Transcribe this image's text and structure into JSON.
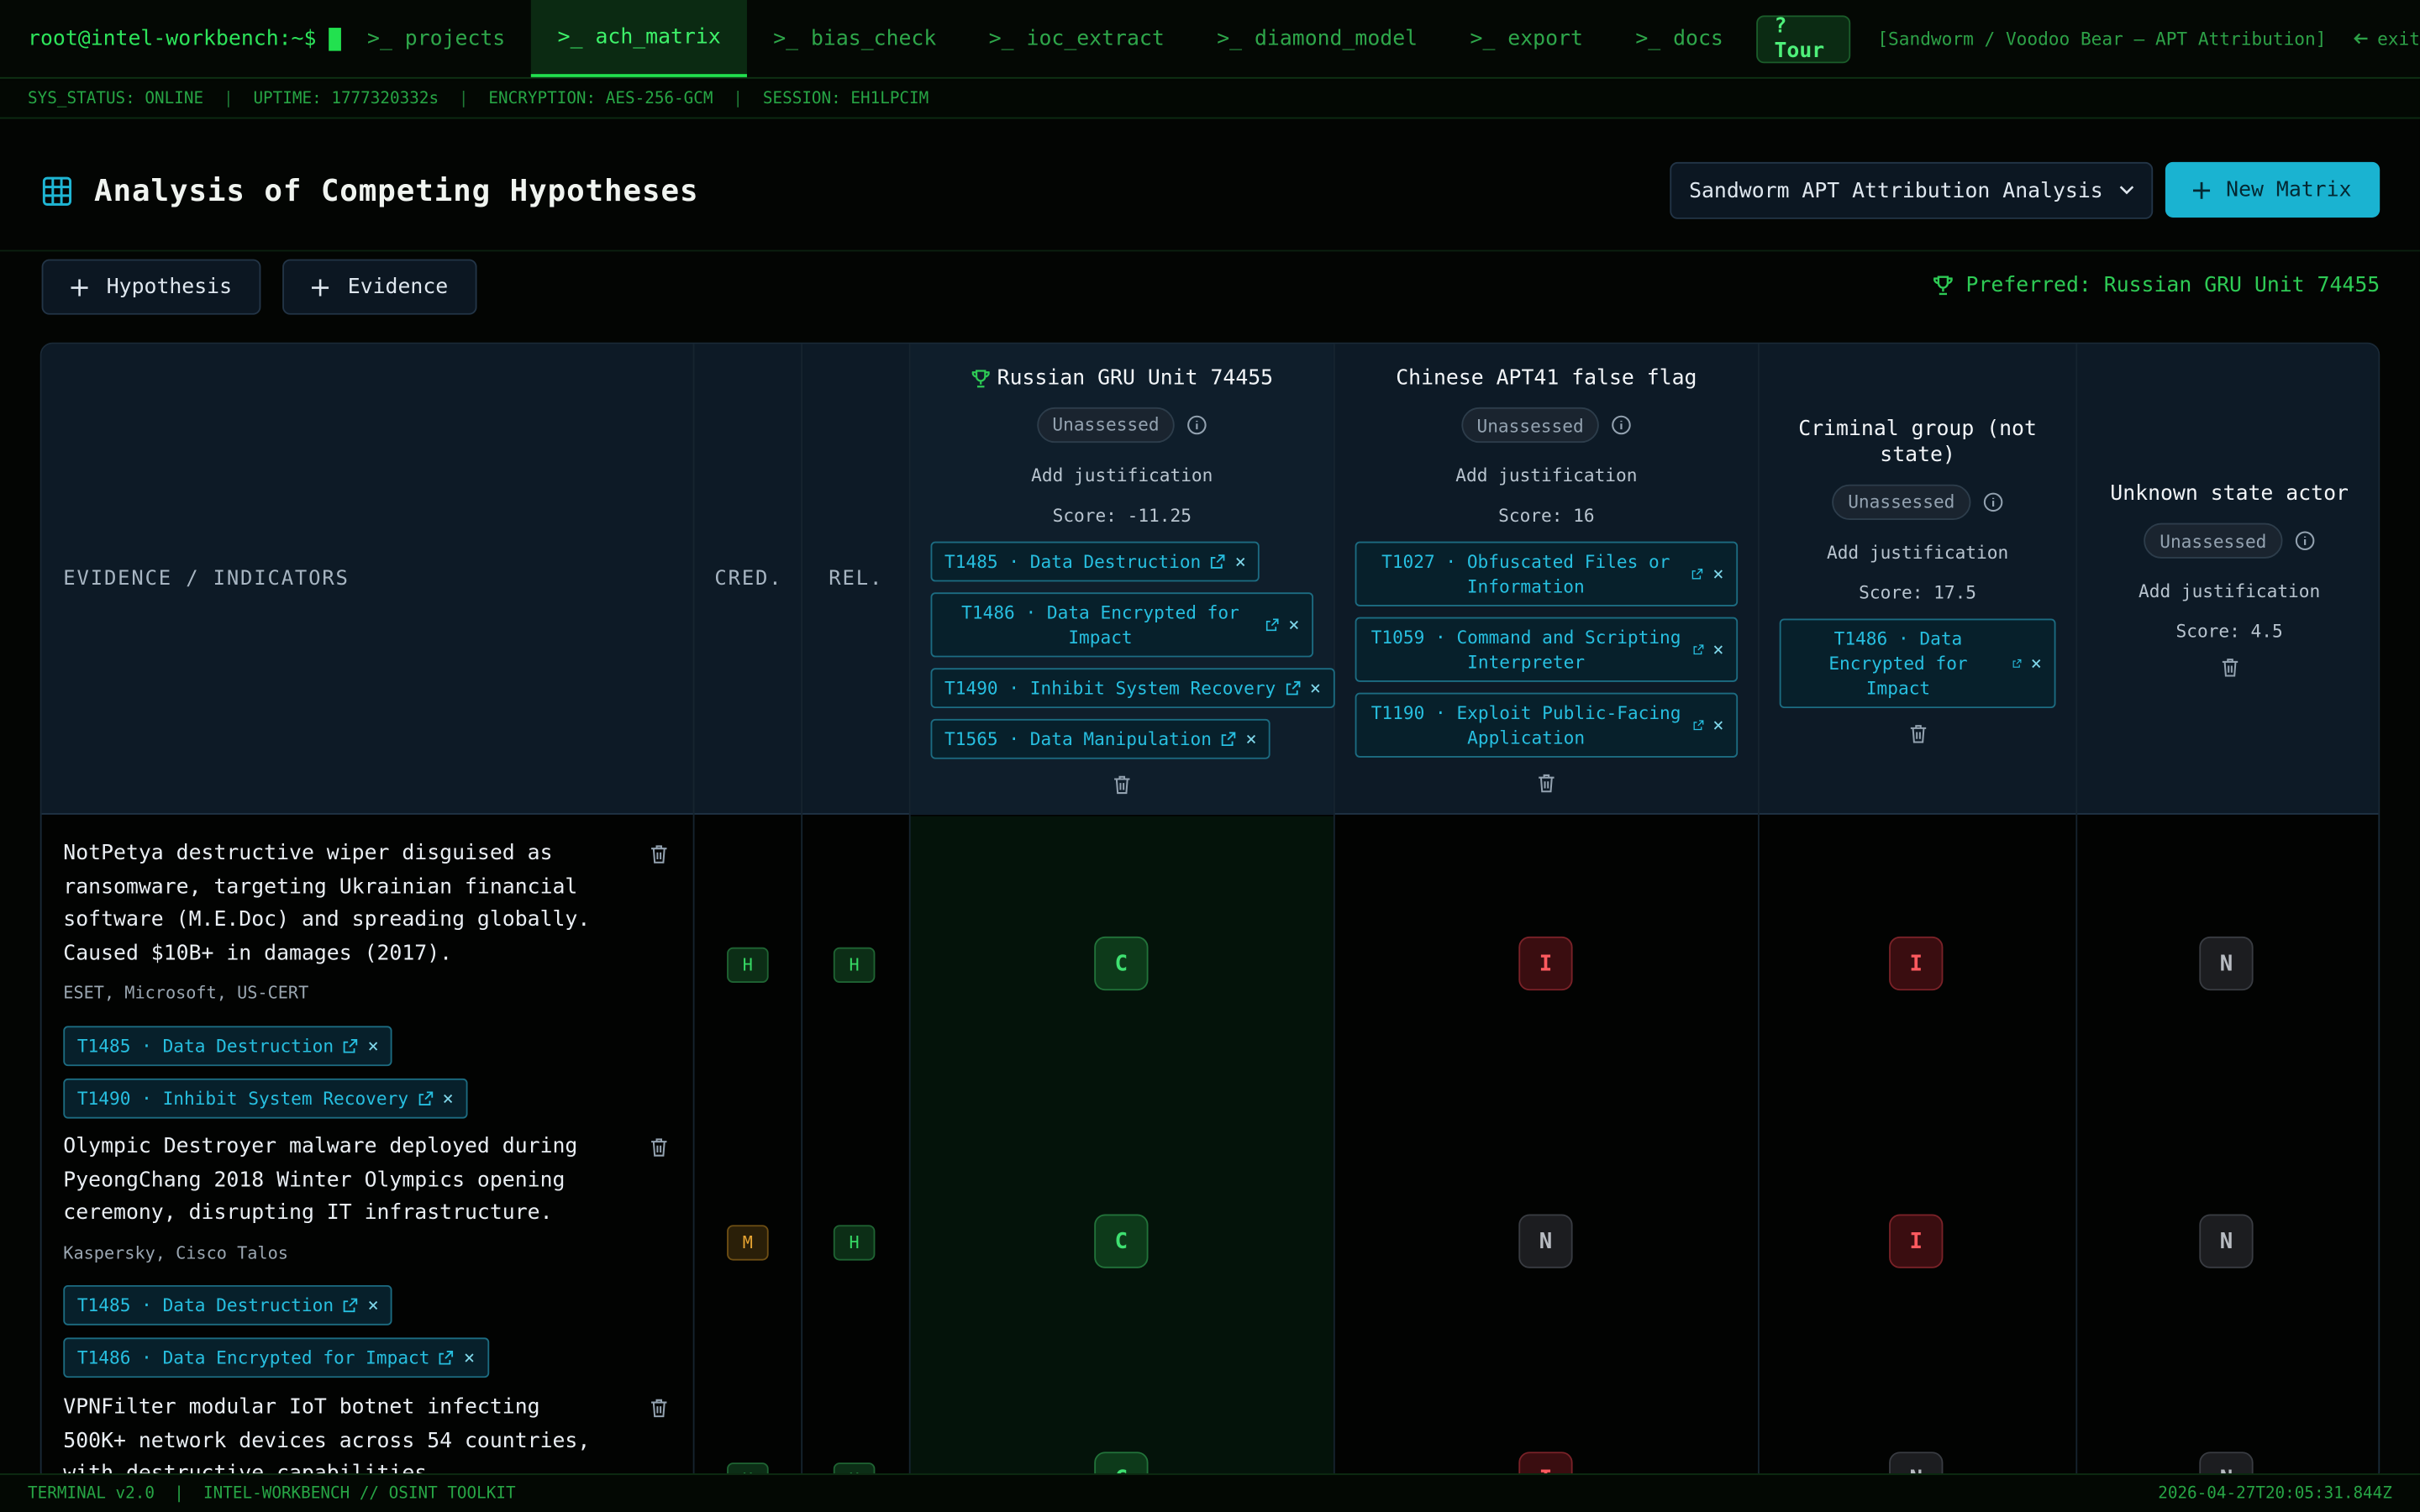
{
  "topbar": {
    "prompt": "root@intel-workbench:~$",
    "tabs": [
      {
        "label": ">_ projects",
        "active": false
      },
      {
        "label": ">_ ach_matrix",
        "active": true
      },
      {
        "label": ">_ bias_check",
        "active": false
      },
      {
        "label": ">_ ioc_extract",
        "active": false
      },
      {
        "label": ">_ diamond_model",
        "active": false
      },
      {
        "label": ">_ export",
        "active": false
      },
      {
        "label": ">_ docs",
        "active": false
      }
    ],
    "tour_label": "? Tour",
    "project_label": "[Sandworm / Voodoo Bear — APT Attribution]",
    "exit_label": "exit"
  },
  "status": {
    "items": [
      "SYS_STATUS: ONLINE",
      "UPTIME: 1777320332s",
      "ENCRYPTION: AES-256-GCM",
      "SESSION: EH1LPCIM"
    ]
  },
  "page": {
    "title": "Analysis of Competing Hypotheses",
    "matrix_select": "Sandworm APT Attribution Analysis",
    "new_matrix_label": "New Matrix",
    "add_hypothesis_label": "Hypothesis",
    "add_evidence_label": "Evidence",
    "preferred_label": "Preferred: Russian GRU Unit 74455"
  },
  "matrix": {
    "evidence_header": "EVIDENCE / INDICATORS",
    "cred_header": "CRED.",
    "rel_header": "REL.",
    "justification_label": "Add justification",
    "hypotheses": [
      {
        "name": "Russian GRU Unit 74455",
        "preferred": true,
        "status": "Unassessed",
        "score": "Score: -11.25",
        "tags": [
          "T1485 · Data Destruction",
          "T1486 · Data Encrypted for Impact",
          "T1490 · Inhibit System Recovery",
          "T1565 · Data Manipulation"
        ]
      },
      {
        "name": "Chinese APT41 false flag",
        "preferred": false,
        "status": "Unassessed",
        "score": "Score: 16",
        "tags": [
          "T1027 · Obfuscated Files or Information",
          "T1059 · Command and Scripting Interpreter",
          "T1190 · Exploit Public-Facing Application"
        ]
      },
      {
        "name": "Criminal group (not state)",
        "preferred": false,
        "status": "Unassessed",
        "score": "Score: 17.5",
        "tags": [
          "T1486 · Data Encrypted for Impact"
        ]
      },
      {
        "name": "Unknown state actor",
        "preferred": false,
        "status": "Unassessed",
        "score": "Score: 4.5",
        "tags": []
      }
    ],
    "evidence": [
      {
        "text": "NotPetya destructive wiper disguised as ransomware, targeting Ukrainian financial software (M.E.Doc) and spreading globally. Caused $10B+ in damages (2017).",
        "source": "ESET, Microsoft, US-CERT",
        "tags": [
          "T1485 · Data Destruction",
          "T1490 · Inhibit System Recovery"
        ],
        "cred": "H",
        "rel": "H",
        "ratings": [
          "C",
          "I",
          "I",
          "N"
        ]
      },
      {
        "text": "Olympic Destroyer malware deployed during PyeongChang 2018 Winter Olympics opening ceremony, disrupting IT infrastructure.",
        "source": "Kaspersky, Cisco Talos",
        "tags": [
          "T1485 · Data Destruction",
          "T1486 · Data Encrypted for Impact"
        ],
        "cred": "M",
        "rel": "H",
        "ratings": [
          "C",
          "N",
          "I",
          "N"
        ]
      },
      {
        "text": "VPNFilter modular IoT botnet infecting 500K+ network devices across 54 countries, with destructive capabilities.",
        "source": "",
        "tags": [],
        "cred": "H",
        "rel": "H",
        "ratings": [
          "C",
          "I",
          "N",
          "N"
        ]
      }
    ]
  },
  "footer": {
    "left": "TERMINAL v2.0  |  INTEL-WORKBENCH // OSINT TOOLKIT",
    "right": "2026-04-27T20:05:31.844Z"
  },
  "colors": {
    "terminal_green": "#22e14f",
    "accent_cyan": "#1ab3d1",
    "consistent": "#3fe071",
    "inconsistent": "#ff5a5f",
    "neutral": "#b8bcc2",
    "medium": "#e8a532"
  },
  "icons": [
    "grid-icon",
    "chevron-down-icon",
    "plus-icon",
    "trophy-icon",
    "info-icon",
    "trash-icon",
    "external-link-icon",
    "close-icon",
    "arrow-left-icon"
  ]
}
